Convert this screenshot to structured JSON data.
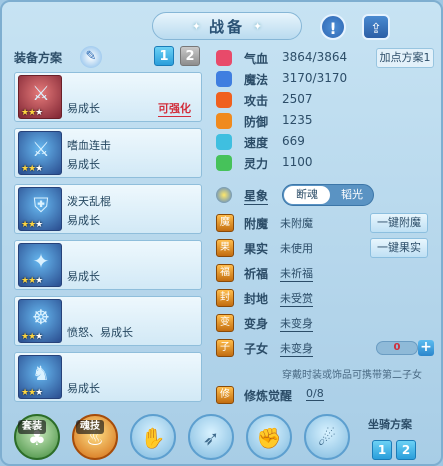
{
  "header": {
    "title": "战备",
    "alert_symbol": "!",
    "share_symbol": "⇪"
  },
  "equip_plan": {
    "label": "装备方案",
    "pages": [
      "1",
      "2"
    ]
  },
  "cards": [
    {
      "line1": "",
      "line2": "易成长",
      "badge": "可强化",
      "stars": 2,
      "glyph": "⚔",
      "first": true
    },
    {
      "line1": "嗜血连击",
      "line2": "易成长",
      "badge": "",
      "stars": 2,
      "glyph": "⚔"
    },
    {
      "line1": "泼天乱棍",
      "line2": "易成长",
      "badge": "",
      "stars": 2,
      "glyph": "⛨"
    },
    {
      "line1": "",
      "line2": "易成长",
      "badge": "",
      "stars": 2,
      "glyph": "✦"
    },
    {
      "line1": "",
      "line2": "愤怒、易成长",
      "badge": "",
      "stars": 2,
      "glyph": "☸"
    },
    {
      "line1": "",
      "line2": "易成长",
      "badge": "",
      "stars": 2,
      "glyph": "♞"
    }
  ],
  "stats": [
    {
      "label": "气血",
      "value": "3864/3864",
      "color": "#e84a6a"
    },
    {
      "label": "魔法",
      "value": "3170/3170",
      "color": "#3f7ee0"
    },
    {
      "label": "攻击",
      "value": "2507",
      "color": "#f0601e"
    },
    {
      "label": "防御",
      "value": "1235",
      "color": "#f08a1e"
    },
    {
      "label": "速度",
      "value": "669",
      "color": "#3fbfe0"
    },
    {
      "label": "灵力",
      "value": "1100",
      "color": "#46c25a"
    }
  ],
  "add_plan_label": "加点方案1",
  "xiangxiang": {
    "label": "星象",
    "opt1": "断魂",
    "opt2": "韬光"
  },
  "attachments": [
    {
      "label": "附魔",
      "value": "未附魔",
      "button": "一键附魔",
      "underline": false,
      "icon": "魔"
    },
    {
      "label": "果实",
      "value": "未使用",
      "button": "一键果实",
      "underline": false,
      "icon": "果"
    },
    {
      "label": "祈福",
      "value": "未祈福",
      "button": "",
      "underline": true,
      "icon": "福"
    },
    {
      "label": "封地",
      "value": "未受赏",
      "button": "",
      "underline": true,
      "icon": "封"
    },
    {
      "label": "变身",
      "value": "未变身",
      "button": "",
      "underline": true,
      "icon": "变"
    },
    {
      "label": "子女",
      "value": "未变身",
      "button": "",
      "underline": true,
      "icon": "子",
      "counter": "0"
    }
  ],
  "child_note": "穿戴时装或饰品可携带第二子女",
  "cultivate": {
    "label": "修炼觉醒",
    "value": "0/8",
    "icon": "修"
  },
  "skills": [
    {
      "tag": "套装",
      "glyph": "♣",
      "style": "g"
    },
    {
      "tag": "魂技",
      "glyph": "♨",
      "style": "r"
    },
    {
      "tag": "",
      "glyph": "✋",
      "style": ""
    },
    {
      "tag": "",
      "glyph": "➶",
      "style": ""
    },
    {
      "tag": "",
      "glyph": "✊",
      "style": ""
    },
    {
      "tag": "",
      "glyph": "☄",
      "style": ""
    }
  ],
  "mount": {
    "label": "坐骑方案",
    "pages": [
      "1",
      "2"
    ]
  }
}
